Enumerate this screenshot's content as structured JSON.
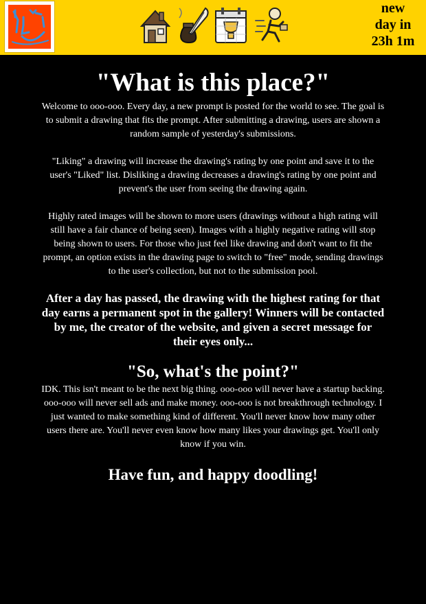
{
  "header": {
    "logo_icon": "doodle-face-logo-icon",
    "nav_icons": [
      "house-icon",
      "ink-quill-icon",
      "calendar-trophy-icon",
      "running-person-icon"
    ],
    "countdown": {
      "line1": "new",
      "line2": "day in",
      "line3": "23h 1m"
    },
    "colors": {
      "bar": "#ffd200",
      "logo_bg": "#ff4300"
    }
  },
  "main": {
    "title": "\"What is this place?\"",
    "paragraphs": [
      "Welcome to ooo-ooo. Every day, a new prompt is posted for the world to see. The goal is to submit a drawing that fits the prompt. After submitting a drawing, users are shown a random sample of yesterday's submissions.",
      "\"Liking\" a drawing will increase the drawing's rating by one point and save it to the user's \"Liked\" list. Disliking a drawing decreases a drawing's rating by one point and prevent's the user from seeing the drawing again.",
      "Highly rated images will be shown to more users (drawings without a high rating will still have a fair chance of being seen). Images with a highly negative rating will stop being shown to users. For those who just feel like drawing and don't want to fit the prompt, an option exists in the drawing page to switch to \"free\" mode, sending drawings to the user's collection, but not to the submission pool."
    ],
    "winner_text": "After a day has passed, the drawing with the highest rating for that day earns a permanent spot in the gallery! Winners will be contacted by me, the creator of the website, and given a secret message for their eyes only...",
    "point_heading": "\"So, what's the point?\"",
    "point_text": "IDK. This isn't meant to be the next big thing. ooo-ooo will never have a startup backing. ooo-ooo will never sell ads and make money. ooo-ooo is not breakthrough technology. I just wanted to make something kind of different. You'll never know how many other users there are. You'll never even know how many likes your drawings get. You'll only know if you win.",
    "closing": "Have fun, and happy doodling!"
  }
}
